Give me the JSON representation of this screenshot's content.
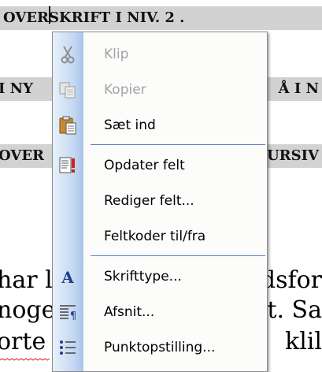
{
  "document": {
    "heading_row_1": "OVERSKRIFT I NIV. 2 .",
    "heading_row_2_left": "I NY",
    "heading_row_2_right": "Å I N",
    "heading_row_3_left": "OVER",
    "heading_row_3_right": "URSIV",
    "body_left": [
      "har l",
      "noge",
      "orte"
    ],
    "body_right": [
      "dsfor",
      "t. Sa",
      "klil"
    ]
  },
  "context_menu": {
    "items": [
      {
        "label": "Klip",
        "enabled": false,
        "icon": "scissors-icon"
      },
      {
        "label": "Kopier",
        "enabled": false,
        "icon": "copy-icon"
      },
      {
        "label": "Sæt ind",
        "enabled": true,
        "icon": "paste-icon"
      },
      {
        "label": "Opdater felt",
        "enabled": true,
        "icon": "update-field-icon"
      },
      {
        "label": "Rediger felt...",
        "enabled": true,
        "icon": ""
      },
      {
        "label": "Feltkoder til/fra",
        "enabled": true,
        "icon": ""
      },
      {
        "label": "Skrifttype...",
        "enabled": true,
        "icon": "font-icon"
      },
      {
        "label": "Afsnit...",
        "enabled": true,
        "icon": "paragraph-icon"
      },
      {
        "label": "Punktopstilling...",
        "enabled": true,
        "icon": "bullets-icon"
      }
    ]
  },
  "colors": {
    "menu_separator": "#5b81c3",
    "menu_gutter": "#c3d7f1",
    "disabled_text": "#a3a3a3",
    "heading_band": "#d2d2d2"
  }
}
